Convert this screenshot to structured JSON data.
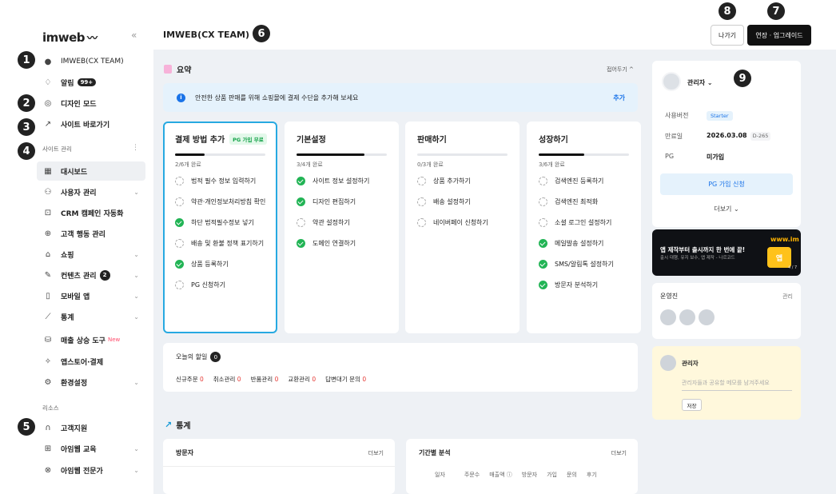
{
  "sidebar": {
    "logo": "imweb",
    "collapse_icon": "«",
    "team": "IMWEB(CX TEAM)",
    "alarm": {
      "label": "알림",
      "badge": "99+"
    },
    "design_mode": "디자인 모드",
    "site_shortcut": "사이트 바로가기",
    "section_site_manage": "사이트 관리",
    "items": [
      {
        "label": "대시보드",
        "icon": "grid-icon"
      },
      {
        "label": "사용자 관리",
        "icon": "users-icon"
      },
      {
        "label": "CRM 캠페인 자동화",
        "icon": "crm-icon"
      },
      {
        "label": "고객 행동 관리",
        "icon": "target-icon"
      },
      {
        "label": "쇼핑",
        "icon": "bag-icon"
      },
      {
        "label": "컨텐츠 관리",
        "icon": "edit-icon",
        "badge": "2"
      },
      {
        "label": "모바일 앱",
        "icon": "mobile-icon"
      },
      {
        "label": "통계",
        "icon": "chart-icon"
      },
      {
        "label": "매출 상승 도구",
        "icon": "tool-icon",
        "new": "New"
      },
      {
        "label": "앱스토어·결제",
        "icon": "app-icon"
      },
      {
        "label": "환경설정",
        "icon": "gear-icon"
      }
    ],
    "section_resources": "리소스",
    "resources": [
      {
        "label": "고객지원",
        "icon": "headset-icon"
      },
      {
        "label": "아임웹 교육",
        "icon": "book-icon"
      },
      {
        "label": "아임웹 전문가",
        "icon": "expert-icon"
      }
    ]
  },
  "markers": [
    "1",
    "2",
    "3",
    "4",
    "5",
    "6",
    "7",
    "8",
    "9"
  ],
  "topbar": {
    "title": "IMWEB(CX TEAM)",
    "exit": "나가기",
    "upgrade": "연장 · 업그레이드"
  },
  "summary": {
    "title": "요약",
    "collapse": "접어두기 ^",
    "notice": "안전한 상품 판매를 위해 쇼핑몰에 결제 수단을 추가해 보세요",
    "notice_action": "추가",
    "cards": [
      {
        "title": "결제 방법 추가",
        "badge": "PG 가입 무료",
        "progress": 0.33,
        "count": "2/6개 완료",
        "items": [
          {
            "label": "법적 필수 정보 입력하기",
            "done": false
          },
          {
            "label": "약관·개인정보처리방침 확인",
            "done": false
          },
          {
            "label": "하단 법적필수정보 넣기",
            "done": true
          },
          {
            "label": "배송 및 환불 정책 표기하기",
            "done": false
          },
          {
            "label": "상품 등록하기",
            "done": true
          },
          {
            "label": "PG 신청하기",
            "done": false
          }
        ]
      },
      {
        "title": "기본설정",
        "progress": 0.75,
        "count": "3/4개 완료",
        "items": [
          {
            "label": "사이트 정보 설정하기",
            "done": true
          },
          {
            "label": "디자인 편집하기",
            "done": true
          },
          {
            "label": "약관 설정하기",
            "done": false
          },
          {
            "label": "도메인 연결하기",
            "done": true
          }
        ]
      },
      {
        "title": "판매하기",
        "progress": 0,
        "count": "0/3개 완료",
        "items": [
          {
            "label": "상품 추가하기",
            "done": false
          },
          {
            "label": "배송 설정하기",
            "done": false
          },
          {
            "label": "네이버페이 신청하기",
            "done": false
          }
        ]
      },
      {
        "title": "성장하기",
        "progress": 0.5,
        "count": "3/6개 완료",
        "items": [
          {
            "label": "검색엔진 등록하기",
            "done": false
          },
          {
            "label": "검색엔진 최적화",
            "done": false
          },
          {
            "label": "소셜 로그인 설정하기",
            "done": false
          },
          {
            "label": "메일발송 설정하기",
            "done": true
          },
          {
            "label": "SMS/알림톡 설정하기",
            "done": true
          },
          {
            "label": "방문자 분석하기",
            "done": true
          }
        ]
      }
    ]
  },
  "todo": {
    "title": "오늘의 할일",
    "count": "0",
    "items": [
      {
        "label": "신규주문",
        "value": "0"
      },
      {
        "label": "취소관리",
        "value": "0"
      },
      {
        "label": "반품관리",
        "value": "0"
      },
      {
        "label": "교환관리",
        "value": "0"
      },
      {
        "label": "답변대기 문의",
        "value": "0"
      }
    ]
  },
  "stats": {
    "title": "통계",
    "visitors": {
      "title": "방문자",
      "more": "더보기"
    },
    "period": {
      "title": "기간별 분석",
      "more": "더보기",
      "columns": [
        "일자",
        "주문수",
        "매출액 ⓘ",
        "방문자",
        "가입",
        "문의",
        "후기"
      ]
    }
  },
  "admin": {
    "name": "관리자 ⌄",
    "rows": [
      {
        "key": "사용버전",
        "value": "Starter"
      },
      {
        "key": "만료일",
        "value": "2026.03.08",
        "extra": "D-265"
      },
      {
        "key": "PG",
        "value": "미가입"
      }
    ],
    "pg_button": "PG 가입 신청",
    "more": "더보기 ⌄"
  },
  "banner": {
    "line1": "앱 제작부터 출시까지 한 번에 끝!",
    "line2": "출시 대행, 유지 보수, 앱 제작 - 나르코드",
    "www": "www.im",
    "app": "앱",
    "page": "4 / 7"
  },
  "operator": {
    "title": "운영진",
    "manage": "관리"
  },
  "memo": {
    "name": "관리자",
    "placeholder": "관리자들과 공유할 메모를 남겨주세요",
    "save": "저장"
  }
}
